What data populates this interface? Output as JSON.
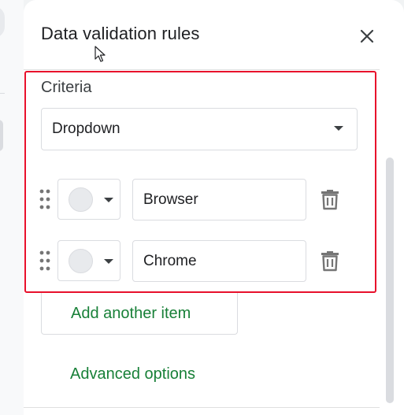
{
  "panel": {
    "title": "Data validation rules",
    "close_icon": "close-icon"
  },
  "criteria": {
    "label": "Criteria",
    "selected": "Dropdown"
  },
  "items": [
    {
      "value": "Browser",
      "color": "#e8eaed"
    },
    {
      "value": "Chrome",
      "color": "#e8eaed"
    }
  ],
  "actions": {
    "add_item": "Add another item",
    "advanced": "Advanced options"
  },
  "colors": {
    "accent_green": "#188038",
    "highlight_red": "#e8102b",
    "border": "#dadce0"
  }
}
